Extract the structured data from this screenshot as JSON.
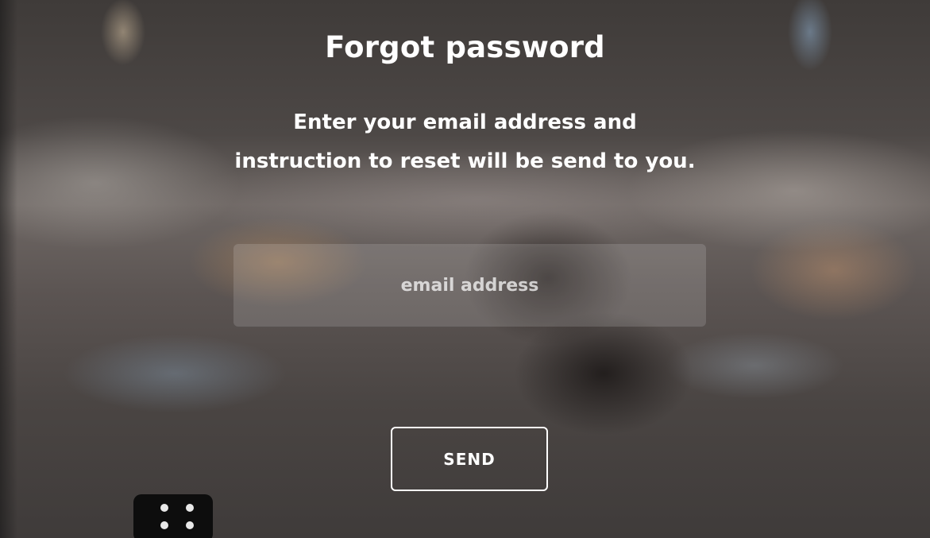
{
  "page": {
    "title": "Forgot password",
    "instructions": [
      "Enter your email address and",
      "instruction to reset will be send to you."
    ]
  },
  "form": {
    "email": {
      "value": "",
      "placeholder": "email address"
    },
    "send_label": "SEND"
  },
  "colors": {
    "text": "#ffffff",
    "field_background": "rgba(255,255,255,0.14)",
    "button_border": "#ffffff"
  }
}
